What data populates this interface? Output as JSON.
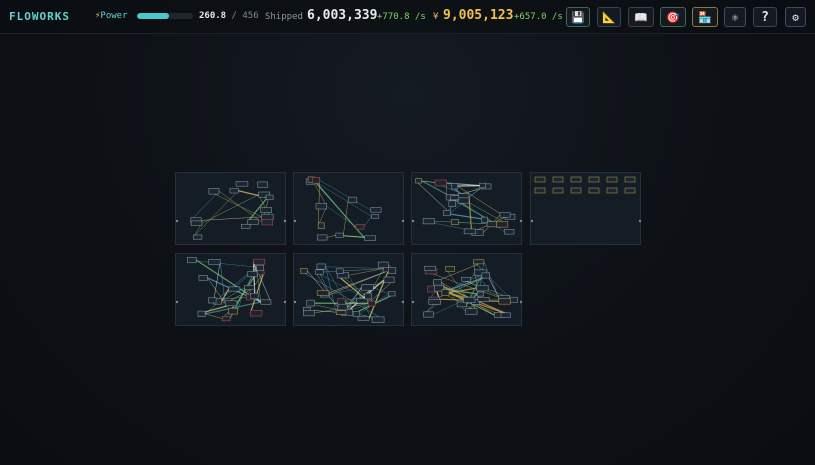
{
  "app": {
    "title": "FLOWORKS"
  },
  "power": {
    "label": "Power",
    "current": "260.8",
    "separator": "/",
    "capacity": "456",
    "fraction": 0.572,
    "color": "#4cc9c6"
  },
  "shipped": {
    "label": "Shipped",
    "value": "6,003,339",
    "rate": "+770.8 /s"
  },
  "money": {
    "symbol": "¥",
    "value": "9,005,123",
    "rate": "+657.0 /s",
    "color": "#f2c14e"
  },
  "toolbar": [
    {
      "icon": "save-icon",
      "glyph": "💾"
    },
    {
      "icon": "blueprint-ruler-icon",
      "glyph": "📐"
    },
    {
      "icon": "book-icon",
      "glyph": "📖"
    },
    {
      "icon": "target-icon",
      "glyph": "🎯"
    },
    {
      "icon": "shop-icon",
      "glyph": "🏪"
    },
    {
      "icon": "atom-icon",
      "glyph": "⚛"
    },
    {
      "icon": "help-icon",
      "glyph": "?"
    },
    {
      "icon": "gear-icon",
      "glyph": "⚙"
    }
  ],
  "layouts": [
    {
      "name": "layout-1"
    },
    {
      "name": "layout-2"
    },
    {
      "name": "layout-3"
    },
    {
      "name": "layout-4"
    },
    {
      "name": "layout-5"
    },
    {
      "name": "layout-6"
    },
    {
      "name": "layout-7"
    }
  ]
}
